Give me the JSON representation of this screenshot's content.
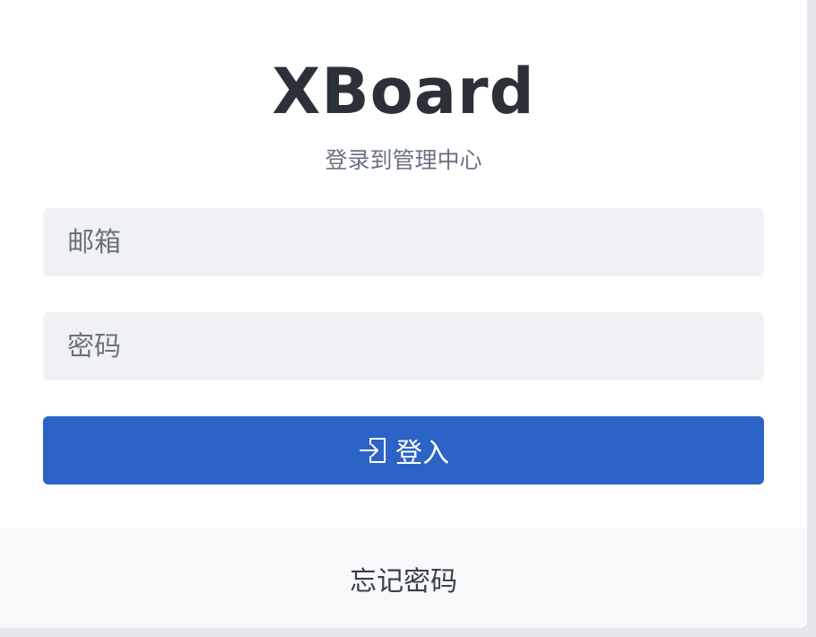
{
  "login": {
    "title": "XBoard",
    "subtitle": "登录到管理中心",
    "email_placeholder": "邮箱",
    "email_value": "",
    "password_placeholder": "密码",
    "password_value": "",
    "login_label": "登入",
    "login_icon": "sign-in-icon",
    "forgot_label": "忘记密码"
  },
  "colors": {
    "accent": "#2b63c7",
    "input_bg": "#f0f1f5",
    "footer_bg": "#f7f8fa",
    "page_bg": "#e6e7ec"
  }
}
